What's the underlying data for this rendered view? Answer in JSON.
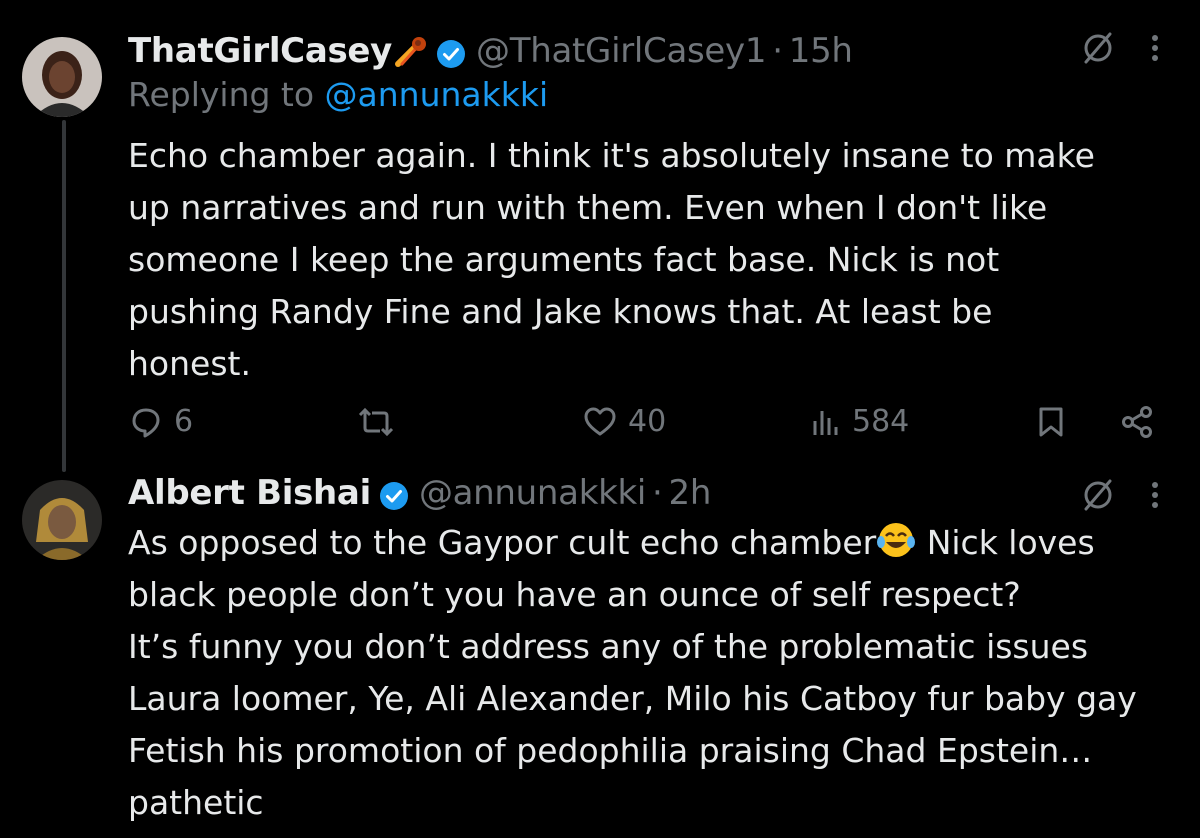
{
  "tweet1": {
    "display_name": "ThatGirlCasey",
    "handle": "@ThatGirlCasey1",
    "separator": "·",
    "time": "15h",
    "replying_prefix": "Replying to",
    "replying_to": "@annunakkki",
    "text": "Echo chamber again. I think it's absolutely insane to make\nup narratives and run with them. Even when I don't like\nsomeone I keep the arguments fact base. Nick is not\npushing Randy Fine and Jake knows that. At least be\nhonest.",
    "replies": "6",
    "likes": "40",
    "views": "584"
  },
  "tweet2": {
    "display_name": "Albert Bishai",
    "handle": "@annunakkki",
    "separator": "·",
    "time": "2h",
    "text_before_emoji": "As opposed to the  Gaypor cult echo chamber",
    "text_after_emoji": " Nick loves\nblack people  don’t you have an ounce of self respect?\nIt’s funny you don’t address any of the problematic issues\nLaura loomer, Ye, Ali Alexander, Milo his Catboy fur baby gay\nFetish his promotion of pedophilia praising Chad Epstein…\npathetic"
  },
  "colors": {
    "background": "#000000",
    "text": "#e7e9ea",
    "muted": "#71767b",
    "accent": "#1d9bf0"
  },
  "icons": [
    "comet-emoji",
    "verified-badge-icon",
    "grok-icon",
    "more-icon",
    "reply-icon",
    "retweet-icon",
    "like-icon",
    "views-icon",
    "bookmark-icon",
    "share-icon",
    "laughing-emoji"
  ]
}
